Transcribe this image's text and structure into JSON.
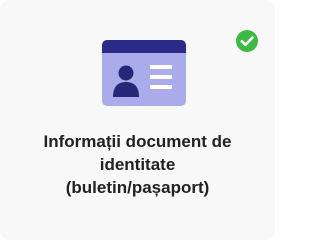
{
  "card": {
    "title_lines": [
      "Informații document de",
      "identitate",
      "(buletin/pașaport)"
    ],
    "status": "completed",
    "illustration": "id-card-icon",
    "status_icon": "checkmark-circle-icon"
  },
  "colors": {
    "card_background": "#f8f8f8",
    "id_card_body": "#a9abea",
    "id_card_header": "#2b2c8a",
    "id_card_person": "#262777",
    "id_card_lines": "#ffffff",
    "check_badge": "#3dba45",
    "title_text": "#222222"
  }
}
